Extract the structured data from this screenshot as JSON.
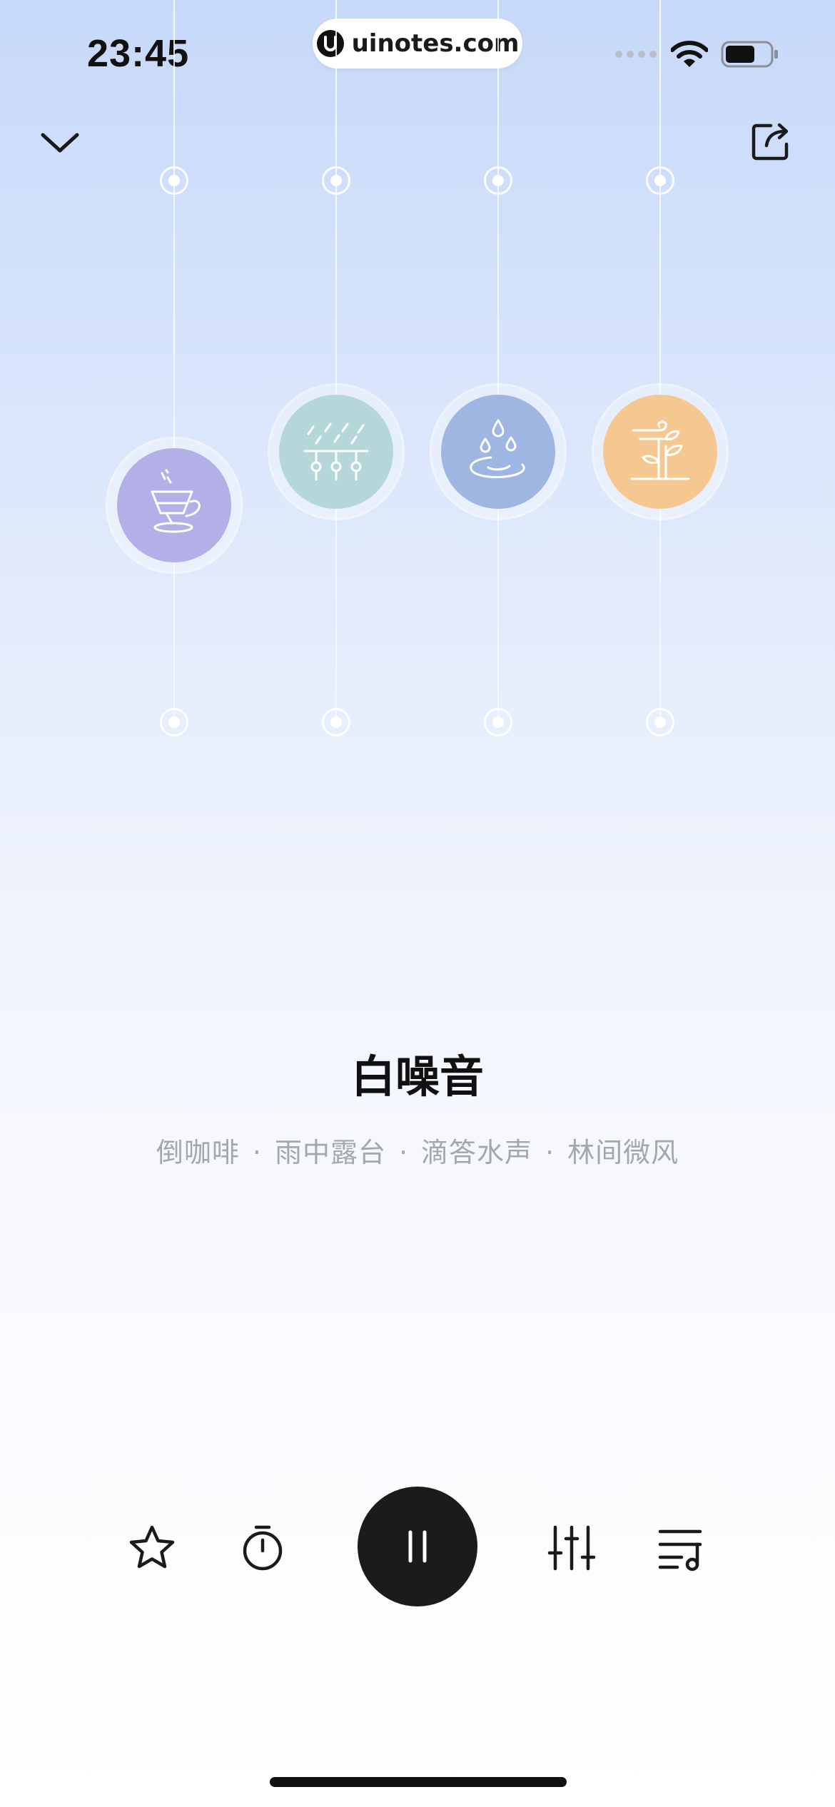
{
  "status_bar": {
    "time": "23:45",
    "icons": [
      "signal-dots-icon",
      "wifi-icon",
      "battery-icon"
    ]
  },
  "watermark": {
    "text": "uinotes.com",
    "icon": "uinotes-logo-icon"
  },
  "header": {
    "collapse_icon": "chevron-down-icon",
    "share_icon": "share-icon"
  },
  "sounds": [
    {
      "name": "倒咖啡",
      "icon": "coffee-drip-icon",
      "color": "#b2b0e6",
      "level": 0.6
    },
    {
      "name": "雨中露台",
      "icon": "rain-terrace-icon",
      "color": "#b5d7da",
      "level": 0.5
    },
    {
      "name": "滴答水声",
      "icon": "water-drop-icon",
      "color": "#9fb5e2",
      "level": 0.5
    },
    {
      "name": "林间微风",
      "icon": "breeze-bamboo-icon",
      "color": "#f5c892",
      "level": 0.5
    }
  ],
  "player": {
    "title": "白噪音",
    "subtitle_items": [
      "倒咖啡",
      "雨中露台",
      "滴答水声",
      "林间微风"
    ],
    "separator": "·"
  },
  "controls": {
    "favorite_icon": "star-icon",
    "timer_icon": "timer-icon",
    "play_state_icon": "pause-icon",
    "mixer_icon": "mixer-sliders-icon",
    "playlist_icon": "playlist-icon"
  },
  "colors": {
    "accent_dark": "#1b1b1b",
    "subtitle": "#a3a7ae"
  }
}
